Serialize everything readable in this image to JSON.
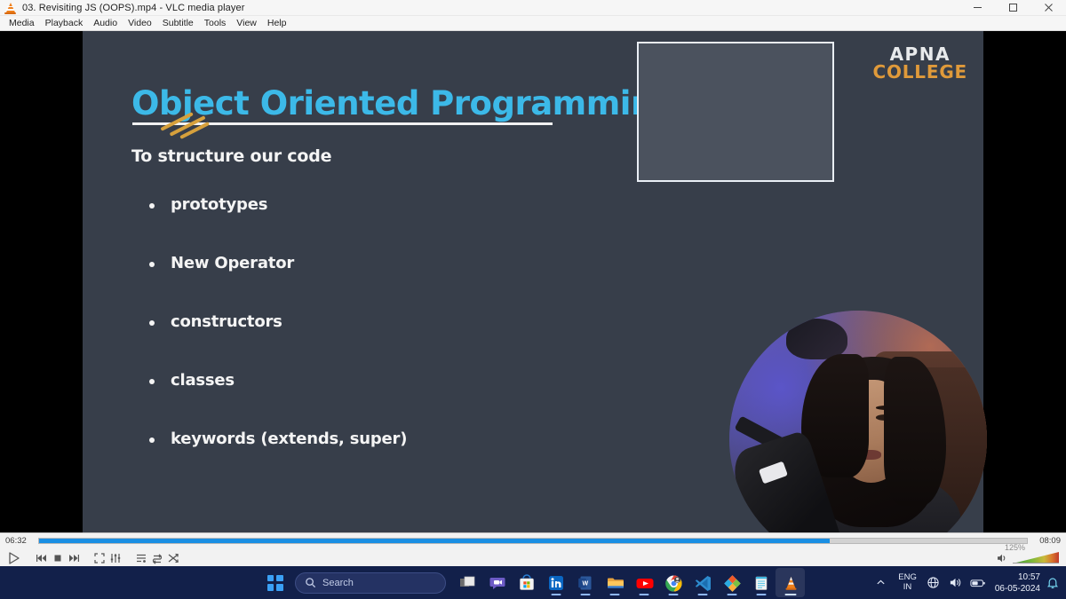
{
  "window": {
    "title": "03. Revisiting JS (OOPS).mp4 - VLC media player",
    "app_icon": "vlc-cone-icon",
    "controls": {
      "minimize": "minimize-icon",
      "maximize": "maximize-icon",
      "close": "close-icon"
    }
  },
  "menubar": {
    "items": [
      "Media",
      "Playback",
      "Audio",
      "Video",
      "Subtitle",
      "Tools",
      "View",
      "Help"
    ]
  },
  "slide": {
    "title": "Object Oriented Programming",
    "subtitle": "To structure our code",
    "bullets": [
      "prototypes",
      "New Operator",
      "constructors",
      "classes",
      "keywords (extends, super)"
    ],
    "logo": {
      "line1": "APNA",
      "line2": "COLLEGE"
    },
    "colors": {
      "background": "#373e4a",
      "title": "#3cb9e8",
      "text": "#f4f4f4",
      "underline": "#f2f2f2",
      "slash": "#d6a03c",
      "logo_line1": "#e8eaec",
      "logo_line2": "#e09a3a",
      "placeholder_fill": "#4b525e",
      "placeholder_border": "#e9eef5",
      "letterbox": "#000000"
    }
  },
  "player": {
    "elapsed": "06:32",
    "total": "08:09",
    "progress_percent": 80,
    "progress_color": "#1a8fe3",
    "volume_label": "125%",
    "buttons": [
      {
        "name": "play-button",
        "icon": "play-icon"
      },
      {
        "name": "previous-button",
        "icon": "skip-backward-icon"
      },
      {
        "name": "stop-button",
        "icon": "stop-icon"
      },
      {
        "name": "next-button",
        "icon": "skip-forward-icon"
      },
      {
        "name": "fullscreen-button",
        "icon": "fullscreen-icon"
      },
      {
        "name": "effects-button",
        "icon": "equalizer-icon"
      },
      {
        "name": "playlist-button",
        "icon": "playlist-icon"
      },
      {
        "name": "loop-button",
        "icon": "loop-icon"
      },
      {
        "name": "shuffle-button",
        "icon": "shuffle-icon"
      }
    ]
  },
  "taskbar": {
    "start": "windows-start-icon",
    "search_placeholder": "Search",
    "search_icon": "search-icon",
    "apps": [
      {
        "name": "task-view",
        "icon": "task-view-icon",
        "active": false
      },
      {
        "name": "chat",
        "icon": "chat-icon",
        "active": false
      },
      {
        "name": "microsoft-store",
        "icon": "store-icon",
        "active": false
      },
      {
        "name": "linkedin",
        "icon": "linkedin-icon",
        "active": false
      },
      {
        "name": "word",
        "icon": "word-icon",
        "active": false
      },
      {
        "name": "file-explorer",
        "icon": "folder-icon",
        "active": false
      },
      {
        "name": "youtube",
        "icon": "youtube-icon",
        "active": false
      },
      {
        "name": "chrome",
        "icon": "chrome-icon",
        "active": false
      },
      {
        "name": "vs-code",
        "icon": "vscode-icon",
        "active": false
      },
      {
        "name": "paint",
        "icon": "paint-icon",
        "active": false
      },
      {
        "name": "notepad",
        "icon": "notepad-icon",
        "active": false
      },
      {
        "name": "vlc",
        "icon": "vlc-cone-icon",
        "active": true
      }
    ],
    "tray": {
      "chevron": "chevron-up-icon",
      "language_line1": "ENG",
      "language_line2": "IN",
      "network": "globe-icon",
      "volume": "speaker-icon",
      "battery": "battery-icon",
      "time": "10:57",
      "date": "06-05-2024",
      "notifications": "bell-icon"
    },
    "background": "#12204a"
  }
}
